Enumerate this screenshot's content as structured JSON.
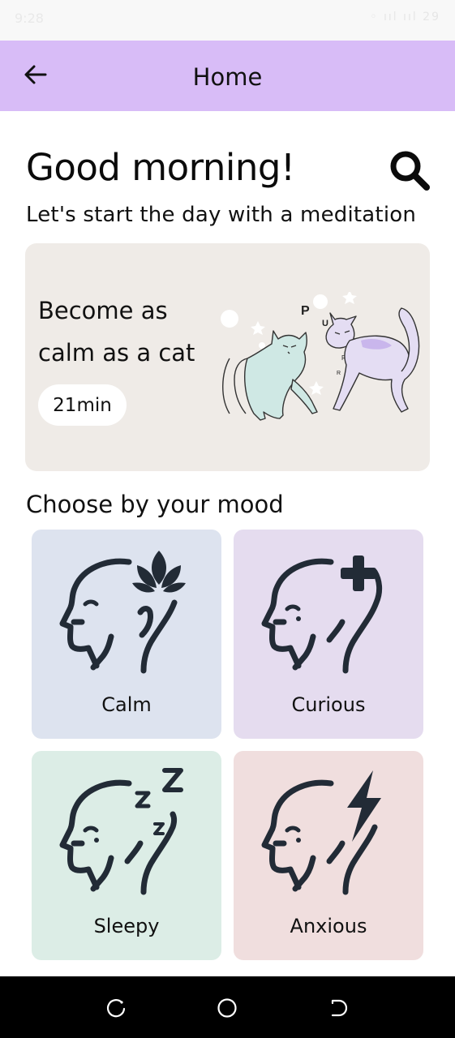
{
  "status_bar": {
    "time": "9:28",
    "indicators": "◦ ııl ııl 29"
  },
  "app_bar": {
    "title": "Home",
    "back_icon": "arrow-left-icon"
  },
  "greeting": "Good morning!",
  "subtitle": "Let's start the day with a meditation",
  "featured": {
    "line1": "Become as",
    "line2": "calm as a cat",
    "duration": "21min",
    "purr_letters": [
      "P",
      "U",
      "R",
      "R",
      "R"
    ]
  },
  "section_title": "Choose by your mood",
  "moods": [
    {
      "label": "Calm",
      "color": "#dde3ef",
      "icon": "lotus-head-icon"
    },
    {
      "label": "Curious",
      "color": "#e5dcef",
      "icon": "plus-head-icon"
    },
    {
      "label": "Sleepy",
      "color": "#dcede6",
      "icon": "sleep-head-icon"
    },
    {
      "label": "Anxious",
      "color": "#f0dede",
      "icon": "lightning-head-icon"
    }
  ],
  "colors": {
    "app_bar": "#d8bcf7",
    "card": "#efebe7",
    "icon_ink": "#222b36"
  }
}
